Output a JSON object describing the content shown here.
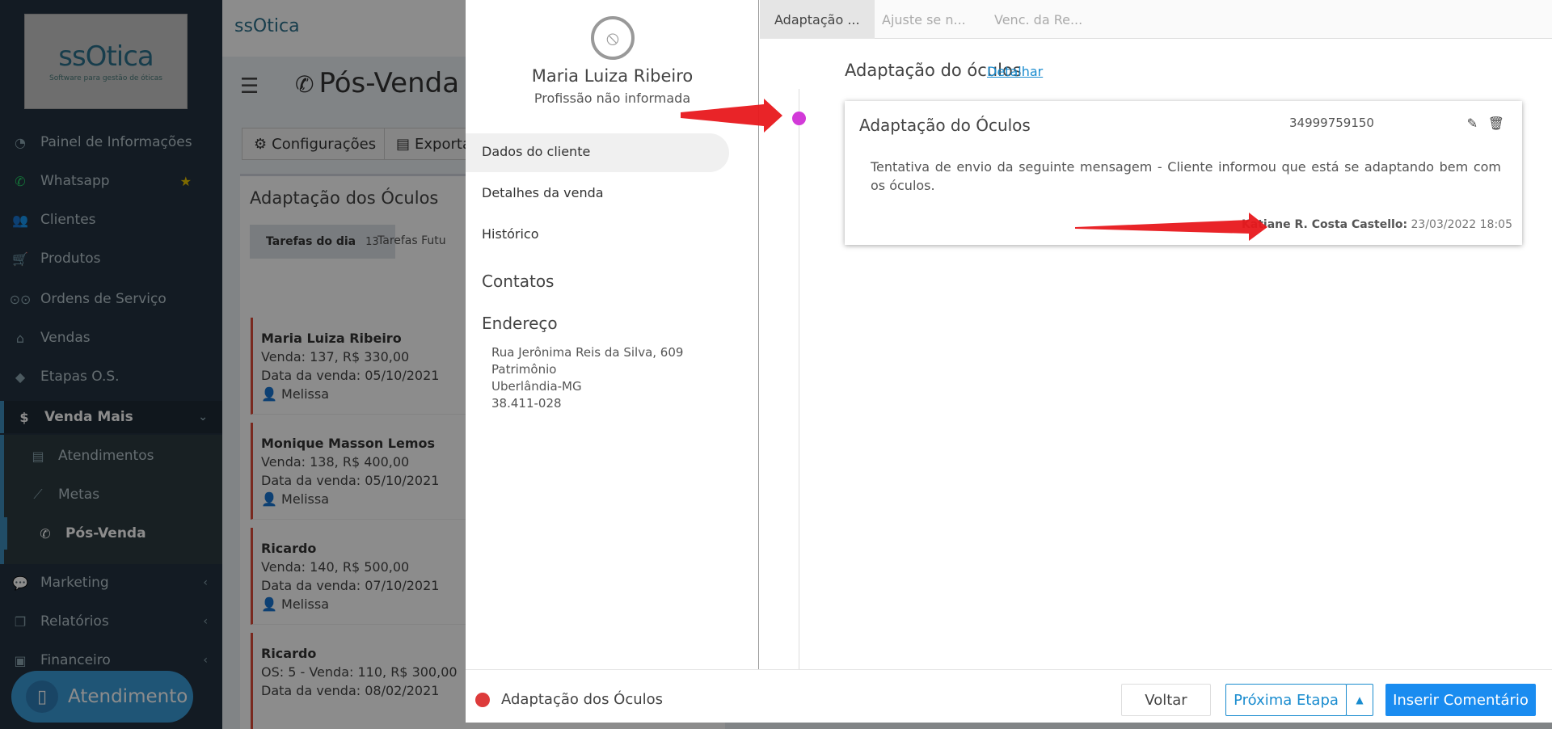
{
  "sidebar": {
    "logo": {
      "brand": "ssOtica",
      "tagline": "Software para gestão de óticas"
    },
    "items": [
      {
        "label": "Painel de Informações",
        "icon": "dashboard-icon"
      },
      {
        "label": "Whatsapp",
        "icon": "whatsapp-icon"
      },
      {
        "label": "Clientes",
        "icon": "users-icon"
      },
      {
        "label": "Produtos",
        "icon": "cart-icon"
      },
      {
        "label": "Ordens de Serviço",
        "icon": "glasses-icon"
      },
      {
        "label": "Vendas",
        "icon": "basket-icon"
      },
      {
        "label": "Etapas O.S.",
        "icon": "tags-icon"
      },
      {
        "label": "Venda Mais",
        "icon": "dollar-icon"
      },
      {
        "label": "Marketing",
        "icon": "comments-icon"
      },
      {
        "label": "Relatórios",
        "icon": "copy-icon"
      },
      {
        "label": "Financeiro",
        "icon": "money-icon"
      }
    ],
    "submenu": [
      {
        "label": "Atendimentos",
        "icon": "clipboard-icon"
      },
      {
        "label": "Metas",
        "icon": "chart-icon"
      },
      {
        "label": "Pós-Venda",
        "icon": "phone-icon"
      }
    ],
    "support_button": "Atendimento"
  },
  "main": {
    "logo_small": "ssOtica",
    "title": "Pós-Venda",
    "toolbar": {
      "config_label": "Configurações",
      "export_label": "Exportar"
    },
    "panel": {
      "title": "Adaptação dos Óculos",
      "tab_today": "Tarefas do dia",
      "tab_today_count": "13",
      "tab_future": "Tarefas Futu",
      "tasks": [
        {
          "name": "Maria Luiza Ribeiro",
          "line1": "Venda: 137, R$ 330,00",
          "line2": "Data da venda: 05/10/2021",
          "user": "Melissa"
        },
        {
          "name": "Monique Masson Lemos",
          "line1": "Venda: 138, R$ 400,00",
          "line2": "Data da venda: 05/10/2021",
          "user": "Melissa"
        },
        {
          "name": "Ricardo",
          "line1": "Venda: 140, R$ 500,00",
          "line2": "Data da venda: 07/10/2021",
          "user": "Melissa"
        },
        {
          "name": "Ricardo",
          "line1": "OS: 5 - Venda: 110, R$ 300,00",
          "line2": "Data da venda: 08/02/2021",
          "user": ""
        }
      ]
    }
  },
  "modal": {
    "client": {
      "name": "Maria Luiza Ribeiro",
      "profession": "Profissão não informada"
    },
    "menu": [
      "Dados do cliente",
      "Detalhes da venda",
      "Histórico"
    ],
    "contacts_title": "Contatos",
    "address_title": "Endereço",
    "address": [
      "Rua Jerônima Reis da Silva, 609",
      "Patrimônio",
      "Uberlândia-MG",
      "38.411-028"
    ],
    "tabs": [
      "Adaptação ...",
      "Ajuste se n...",
      "Venc. da Re..."
    ],
    "stage_title": "Adaptação do óculos",
    "stage_link": "Detalhar",
    "card": {
      "title": "Adaptação do Óculos",
      "phone": "34999759150",
      "message": "Tentativa de envio da seguinte mensagem - Cliente informou que está se adaptando bem com os óculos.",
      "author": "Katiane R. Costa Castello:",
      "datetime": "23/03/2022 18:05"
    },
    "footer": {
      "stage": "Adaptação dos Óculos",
      "back": "Voltar",
      "next": "Próxima Etapa",
      "insert": "Inserir Comentário"
    }
  },
  "colors": {
    "sidebar_bg": "#233240",
    "accent": "#1a8cf0",
    "timeline_dot": "#d23ad8",
    "stage_dot": "#dd3b3b",
    "arrow": "#e8181c"
  }
}
